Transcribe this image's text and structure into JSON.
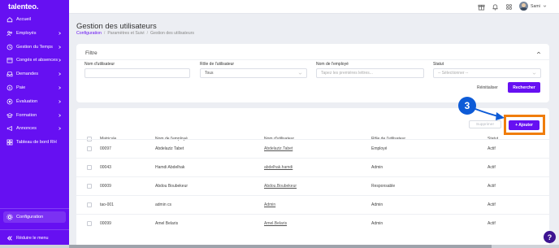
{
  "app": {
    "logo": "talenteo."
  },
  "sidebar": {
    "items": [
      {
        "label": "Accueil",
        "icon": "home-icon",
        "chevron": false
      },
      {
        "label": "Employés",
        "icon": "users-icon",
        "chevron": true
      },
      {
        "label": "Gestion du Temps",
        "icon": "clock-icon",
        "chevron": true
      },
      {
        "label": "Congés et absences",
        "icon": "calendar-icon",
        "chevron": true
      },
      {
        "label": "Demandes",
        "icon": "inbox-icon",
        "chevron": true
      },
      {
        "label": "Paie",
        "icon": "money-icon",
        "chevron": true
      },
      {
        "label": "Évaluation",
        "icon": "target-icon",
        "chevron": true
      },
      {
        "label": "Formation",
        "icon": "graduation-icon",
        "chevron": true
      },
      {
        "label": "Annonces",
        "icon": "megaphone-icon",
        "chevron": true
      },
      {
        "label": "Tableau de bord RH",
        "icon": "dashboard-icon",
        "chevron": false
      }
    ],
    "settings_label": "Configuration",
    "reduce_label": "Réduire le menu"
  },
  "topbar": {
    "user_name": "Sami"
  },
  "header": {
    "title": "Gestion des utilisateurs",
    "breadcrumb": [
      "Configuration",
      "Paramètres et Suivi",
      "Gestion des utilisateurs"
    ]
  },
  "filter": {
    "title": "Filtre",
    "username_label": "Nom d'utilisateur",
    "username_value": "",
    "role_label": "Rôle de l'utilisateur",
    "role_value": "Tous",
    "employee_label": "Nom de l'employé",
    "employee_placeholder": "Tapez les premières lettres...",
    "status_label": "Statut",
    "status_placeholder": "-- Sélectionner --",
    "reset_label": "Réinitialiser",
    "search_label": "Rechercher"
  },
  "actions": {
    "delete_label": "Supprimer",
    "add_label": "+ Ajouter",
    "step_number": "3"
  },
  "table": {
    "headers": [
      "Matricule",
      "Nom de l'employé",
      "Nom d'utilisateur",
      "Rôle de l'utilisateur",
      "Statut"
    ],
    "rows": [
      [
        "00097",
        "Abdelaziz Tabet",
        "Abdelaziz.Tabet",
        "Employé",
        "Actif"
      ],
      [
        "00043",
        "Hamdi Abdelhak",
        "abdelhak.hamdi",
        "Admin",
        "Actif"
      ],
      [
        "00009",
        "Abdou Boubekeur",
        "Abdou.Boubekeur",
        "Responsable",
        "Actif"
      ],
      [
        "tao-001",
        "admin cs",
        "Admin",
        "Admin",
        "Actif"
      ],
      [
        "00099",
        "Amel Belaris",
        "Amel.Belaris",
        "Admin",
        "Actif"
      ]
    ]
  },
  "help": {
    "label": "?"
  },
  "colors": {
    "brand": "#6610f2",
    "highlight": "#f07d0c",
    "step_badge": "#0d5bd7"
  }
}
